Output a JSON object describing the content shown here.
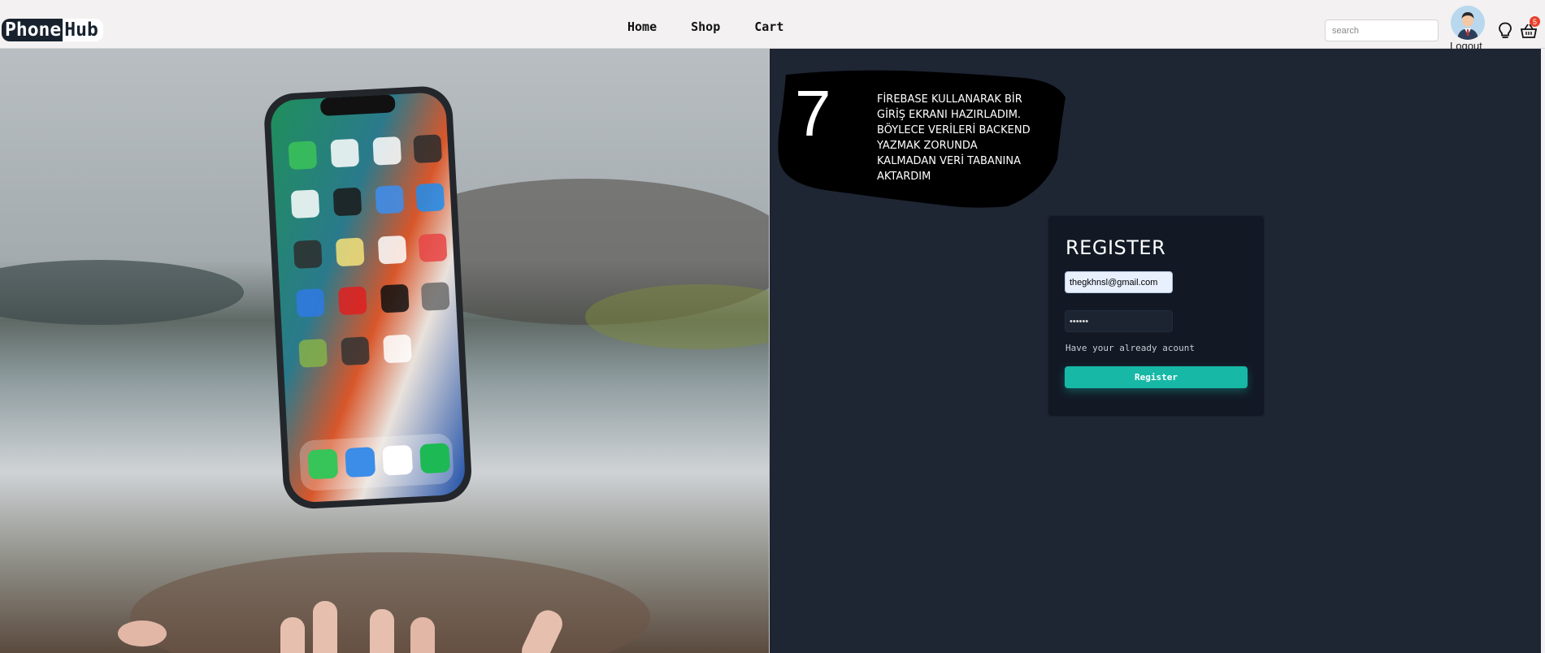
{
  "navbar": {
    "logo_part1": "Phone",
    "logo_part2": "Hub",
    "links": [
      "Home",
      "Shop",
      "Cart"
    ],
    "search_placeholder": "search",
    "logout_label": "Logout",
    "cart_count": "5"
  },
  "annotation": {
    "number": "7",
    "text": "FİREBASE KULLANARAK BİR GİRİŞ EKRANI HAZIRLADIM. BÖYLECE VERİLERİ BACKEND YAZMAK ZORUNDA KALMADAN VERİ TABANINA AKTARDIM"
  },
  "register": {
    "title": "REGISTER",
    "email_value": "thegkhnsl@gmail.com",
    "password_value": "••••••",
    "already_text": "Have your already acount",
    "button_label": "Register"
  },
  "colors": {
    "navbar_bg": "#f3f1f1",
    "panel_bg": "#1e2533",
    "card_bg": "#121925",
    "accent": "#17b8a6",
    "badge": "#e8402a"
  }
}
